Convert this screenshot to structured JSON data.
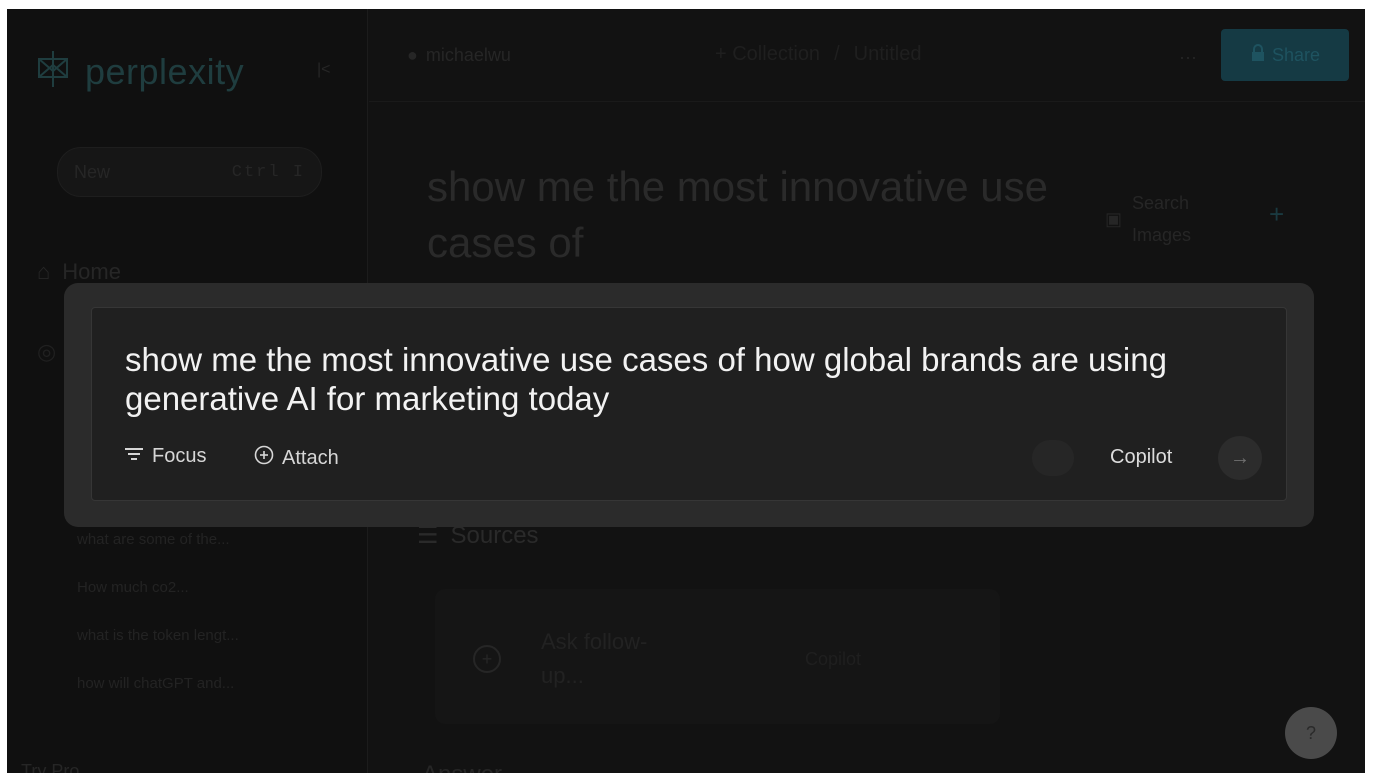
{
  "sidebar": {
    "brand": "perplexity",
    "new_thread": {
      "label": "New",
      "shortcut": "Ctrl I"
    },
    "nav": {
      "home": "Home"
    },
    "history": [
      "what are some of the...",
      "How much co2...",
      "what is the token lengt...",
      "how will chatGPT and..."
    ],
    "try_pro": "Try Pro"
  },
  "header": {
    "user": "michaelwu",
    "collection": "+ Collection",
    "separator": "/",
    "thread_name": "Untitled",
    "more": "···",
    "share": "Share"
  },
  "thread": {
    "title": "show me the most innovative use cases of",
    "search_images": {
      "line1": "Search",
      "line2": "Images"
    },
    "sources": "Sources",
    "followup": {
      "placeholder": "Ask follow-up...",
      "copilot": "Copilot"
    },
    "answer": "Answer",
    "help": "?"
  },
  "modal": {
    "query": "show me the most innovative use cases of how global brands are using generative AI for marketing today",
    "focus": "Focus",
    "attach": "Attach",
    "copilot": "Copilot",
    "submit_icon": "→"
  },
  "colors": {
    "accent": "#20b8cd",
    "overlay_bg": "#2b2b2b",
    "input_bg": "#202020",
    "text": "#f2f2f2"
  }
}
